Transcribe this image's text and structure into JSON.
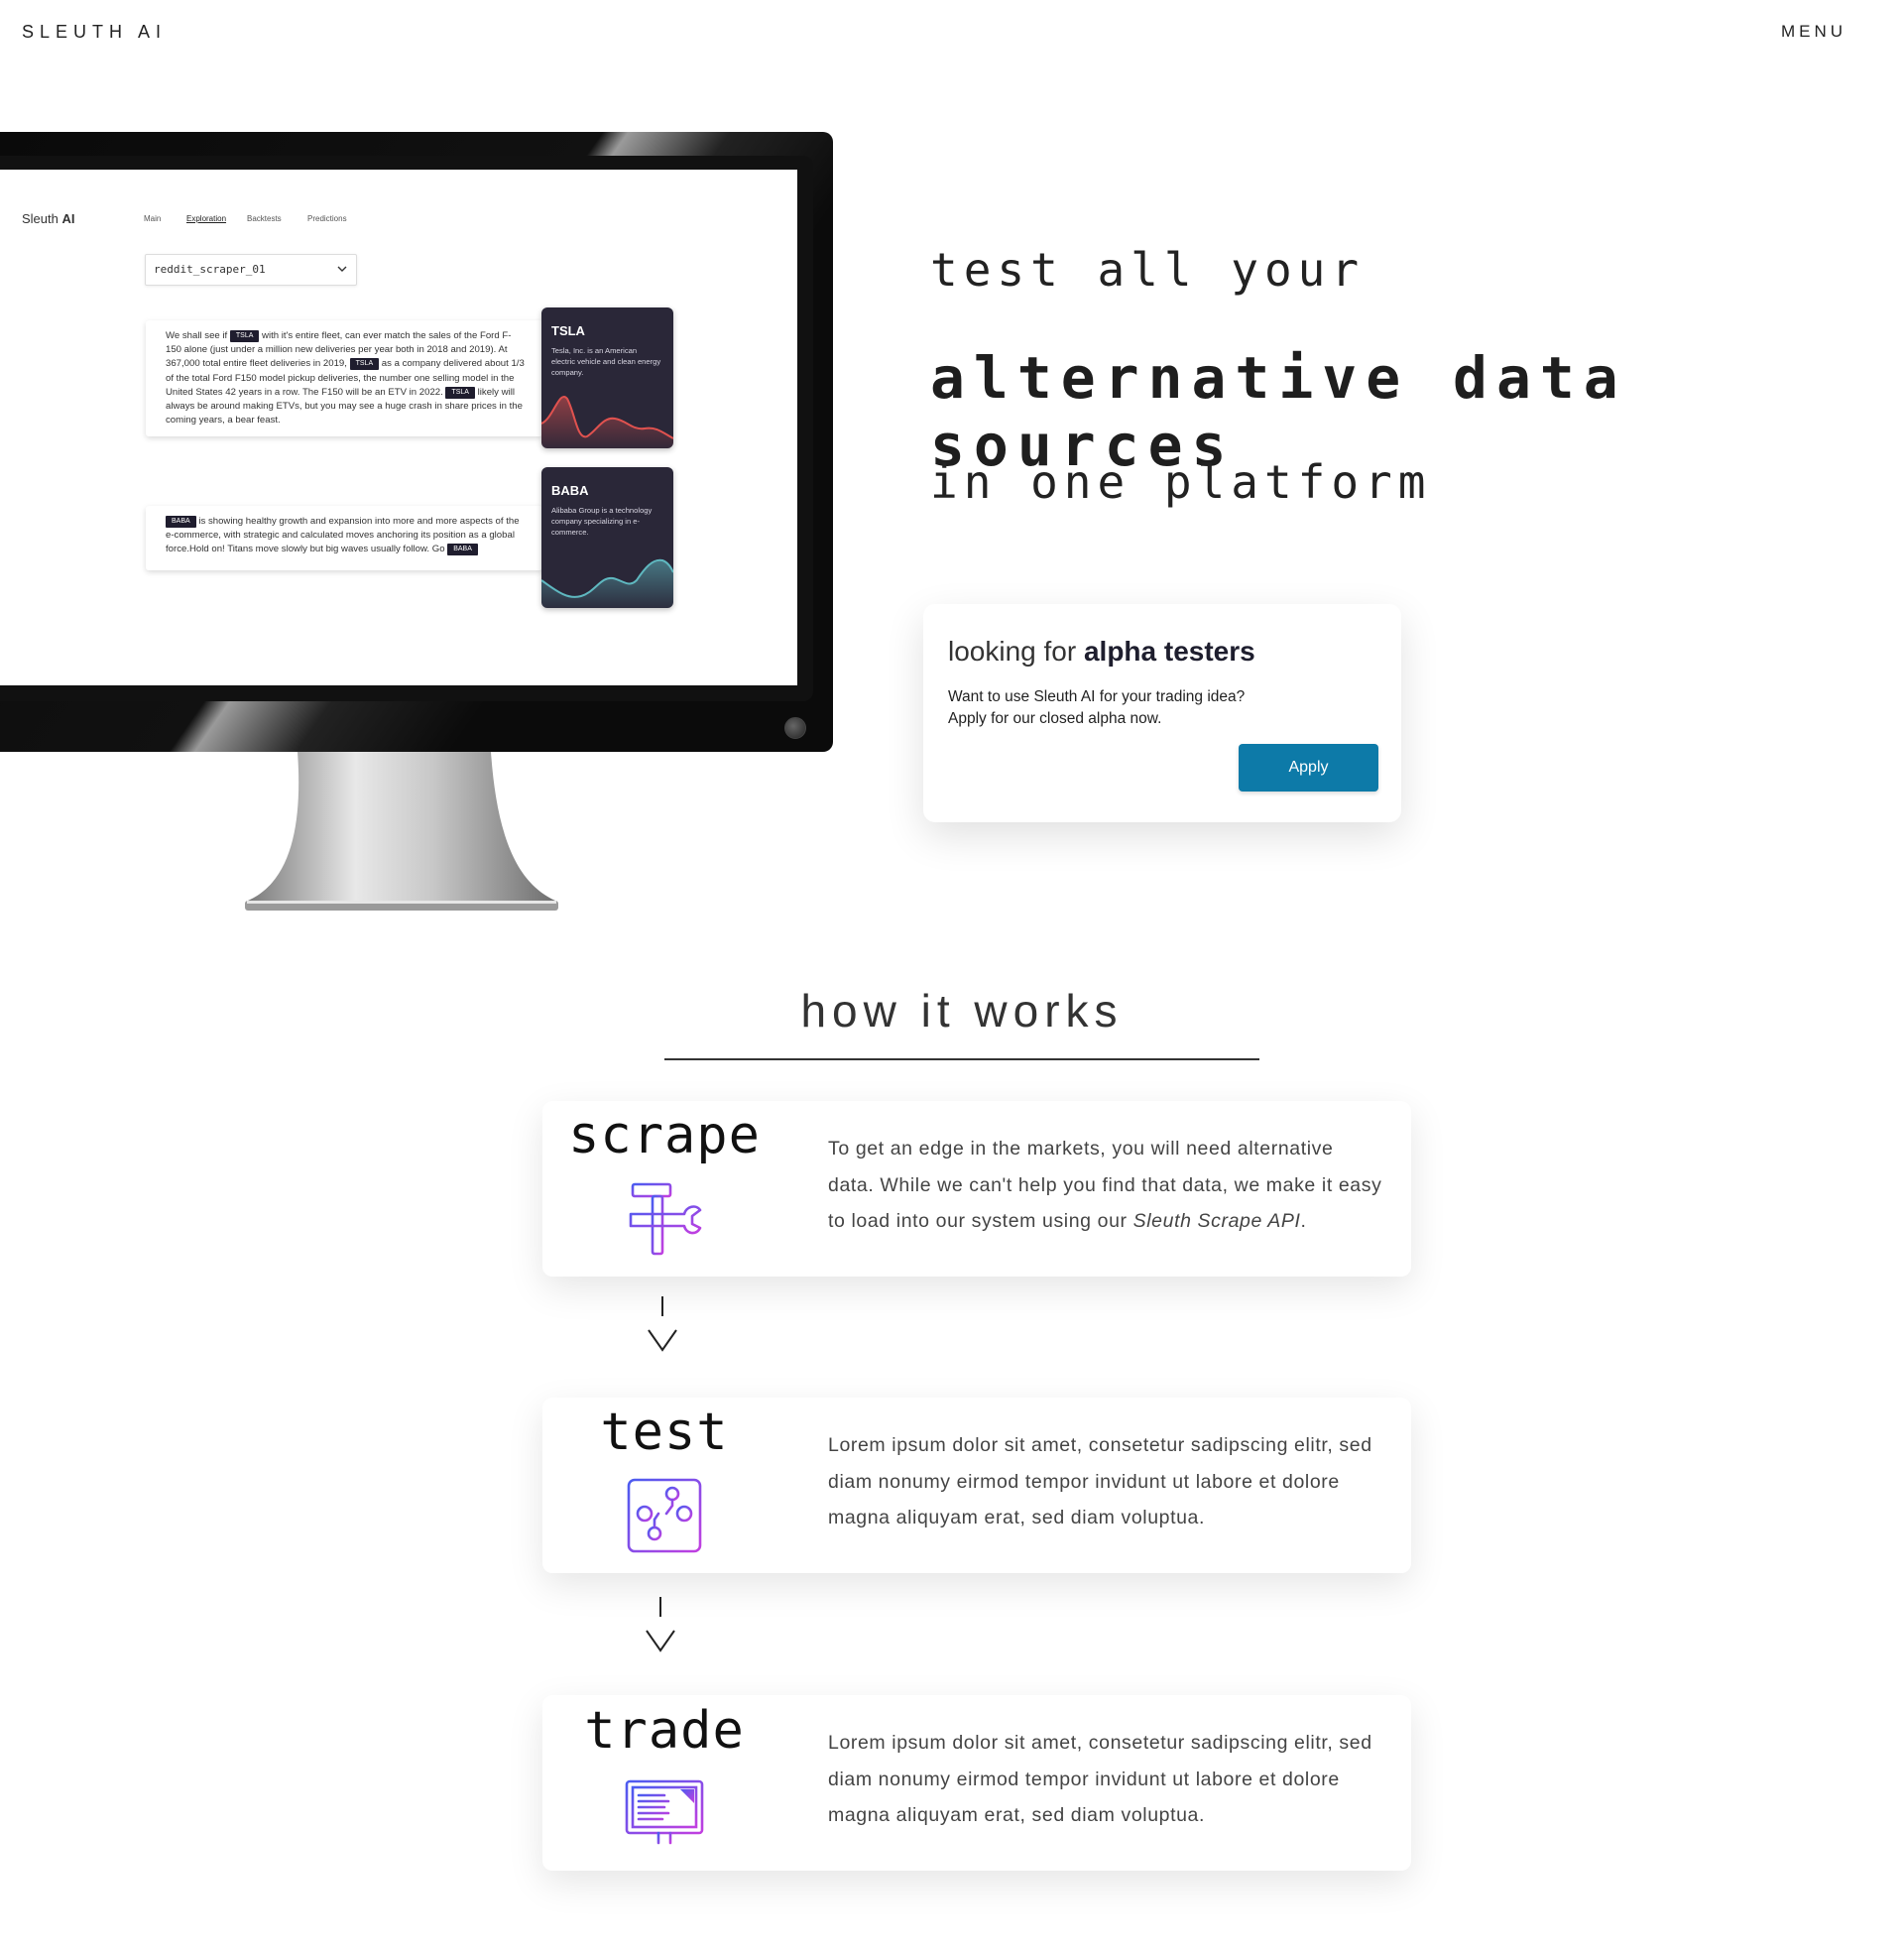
{
  "nav": {
    "brand": "SLEUTH AI",
    "menu": "MENU"
  },
  "screen": {
    "logo_regular": "Sleuth ",
    "logo_bold": "AI",
    "tabs": [
      "Main",
      "Exploration",
      "Backtests",
      "Predictions"
    ],
    "active_tab": "Exploration",
    "dataset": "reddit_scraper_01",
    "post1": {
      "t1": "We shall see if ",
      "tag1": "TSLA",
      "t2": " with it's entire fleet, can ever match the sales of the Ford F-150 alone (just under a million new deliveries per year both in 2018 and 2019). At 367,000 total entire fleet deliveries in 2019, ",
      "tag2": "TSLA",
      "t3": " as a company delivered about 1/3 of the total Ford F150 model pickup deliveries, the number one selling model in the United States 42 years in a row.  The F150 will be an ETV in 2022. ",
      "tag3": "TSLA",
      "t4": " likely will always be around making ETVs, but you may see a huge crash in share prices in the coming years, a bear feast."
    },
    "post2": {
      "tag1": "BABA",
      "t1": " is showing healthy growth and expansion into more and more aspects of the e-commerce, with strategic and calculated moves anchoring its position as a global force.Hold on! Titans move slowly but big waves usually follow. Go ",
      "tag2": "BABA"
    },
    "cards": [
      {
        "ticker": "TSLA",
        "desc": "Tesla, Inc. is an American electric vehicle and clean energy company.",
        "color": "#e0524f"
      },
      {
        "ticker": "BABA",
        "desc": "Alibaba Group is a technology company specializing in e-commerce.",
        "color": "#5fb8c0"
      }
    ]
  },
  "hero": {
    "line1": "test all your",
    "line2": "alternative data sources",
    "line3": "in one platform"
  },
  "alpha": {
    "head_light": "looking for ",
    "head_bold": "alpha testers",
    "desc_line1": "Want to use Sleuth AI for your trading idea?",
    "desc_line2": "Apply for our closed alpha now.",
    "apply": "Apply"
  },
  "how": {
    "title": "how it works",
    "steps": [
      {
        "title": "scrape",
        "icon": "tools-icon",
        "desc": "To get an edge in the markets, you will need alternative data. While we can't help you find that data, we make it easy to load into our system using our ",
        "desc_em": "Sleuth Scrape API",
        "desc_end": "."
      },
      {
        "title": "test",
        "icon": "circuit-icon",
        "desc": "Lorem ipsum dolor sit amet, consetetur sadipscing elitr, sed diam nonumy eirmod tempor invidunt ut labore et dolore magna aliquyam erat, sed diam voluptua."
      },
      {
        "title": "trade",
        "icon": "monitor-icon",
        "desc": "Lorem ipsum dolor sit amet, consetetur sadipscing elitr, sed diam nonumy eirmod tempor invidunt ut labore et dolore magna aliquyam erat, sed diam voluptua."
      }
    ]
  },
  "colors": {
    "accent": "#0d7aa8",
    "icon_gradient_start": "#4a5cf0",
    "icon_gradient_end": "#c23fe0"
  }
}
